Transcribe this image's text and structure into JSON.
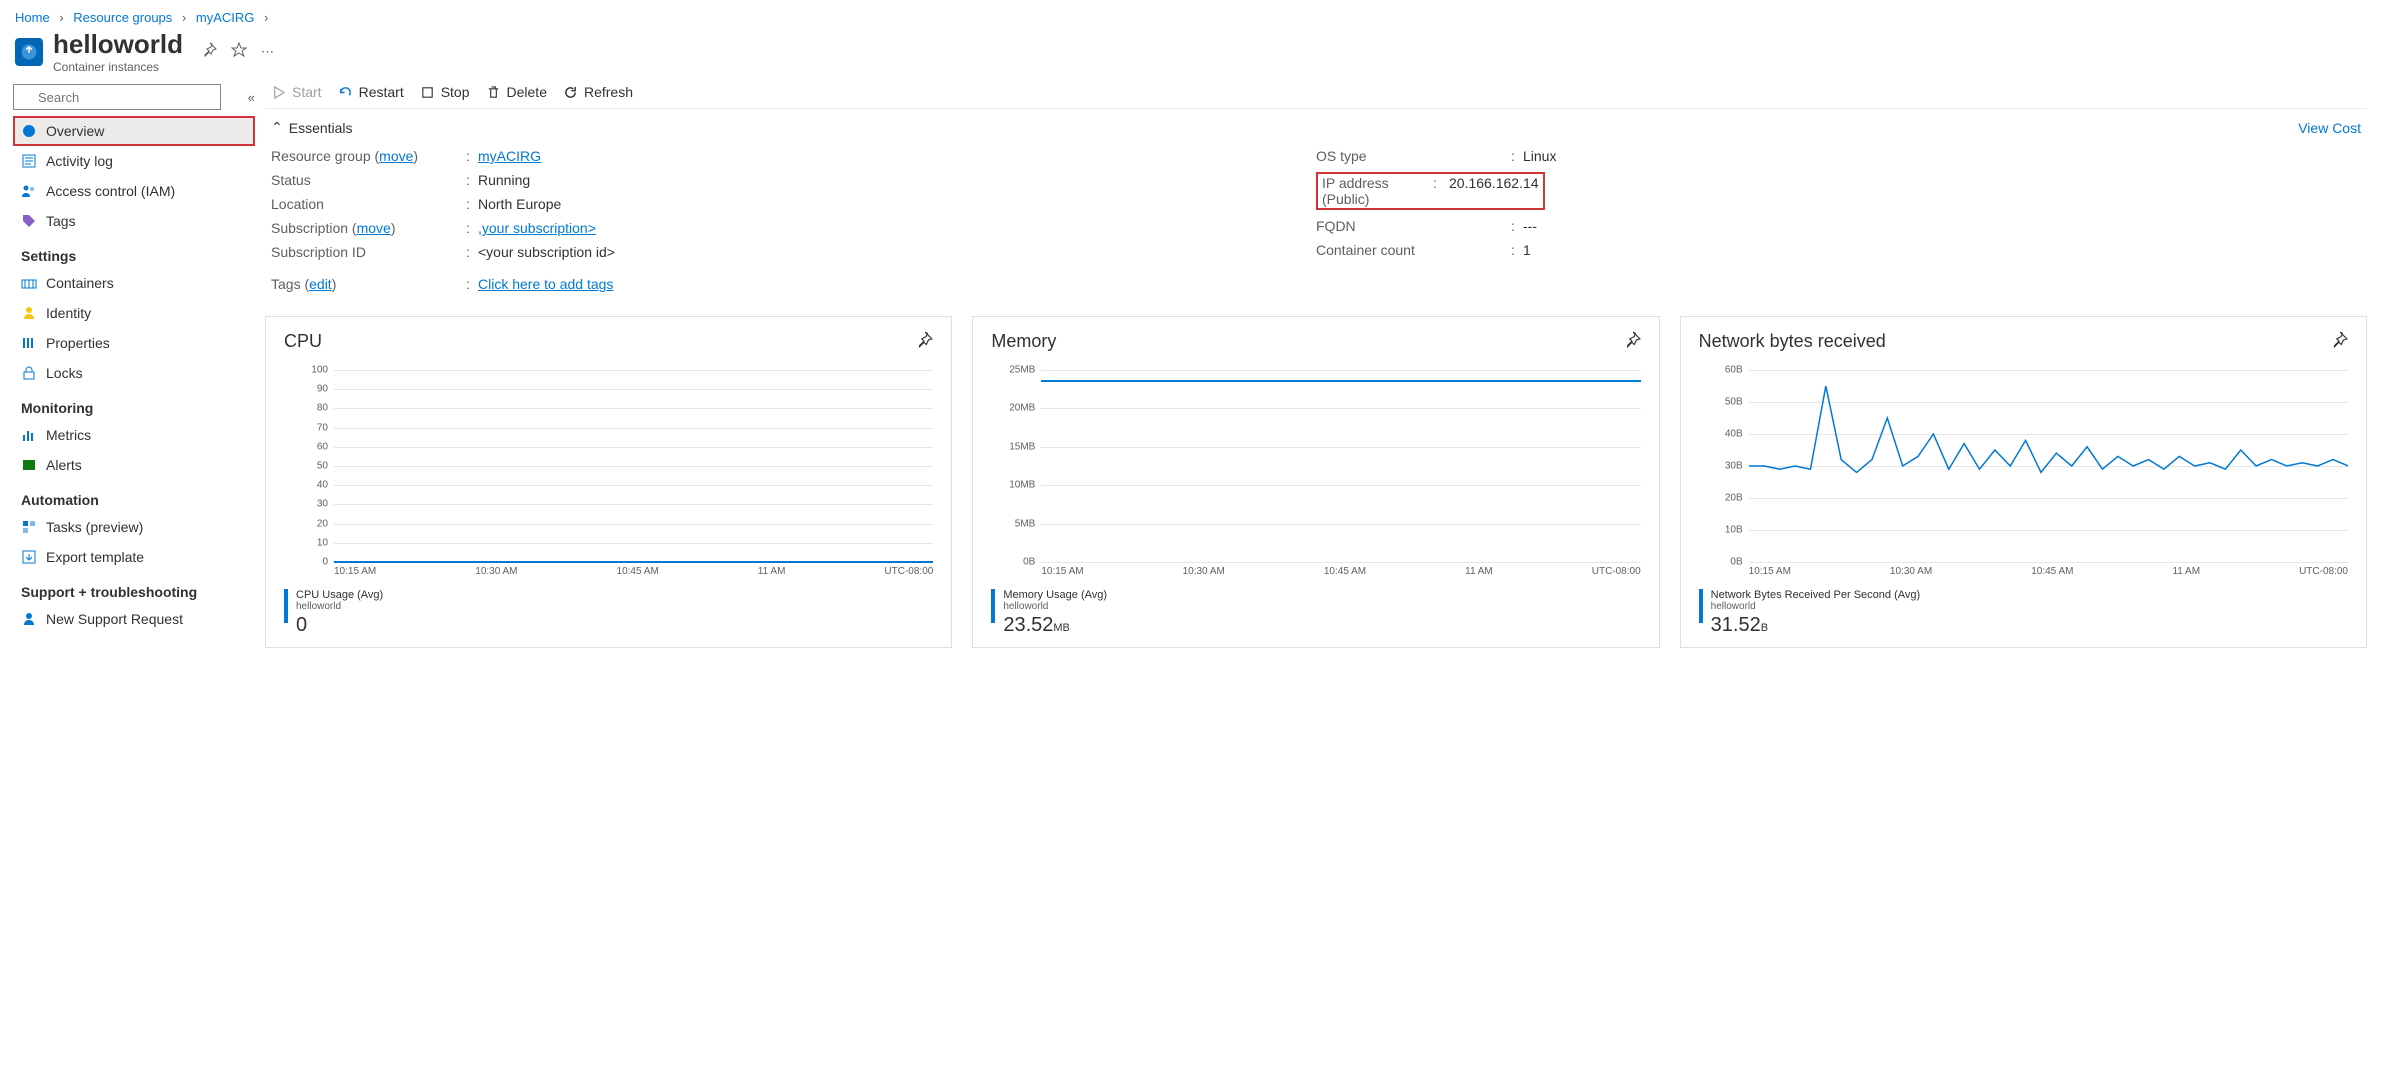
{
  "breadcrumb": {
    "home": "Home",
    "rg": "Resource groups",
    "group": "myACIRG"
  },
  "title": {
    "name": "helloworld",
    "subtype": "Container instances"
  },
  "search": {
    "placeholder": "Search"
  },
  "nav": {
    "overview": "Overview",
    "activity": "Activity log",
    "iam": "Access control (IAM)",
    "tags": "Tags",
    "settings_h": "Settings",
    "containers": "Containers",
    "identity": "Identity",
    "properties": "Properties",
    "locks": "Locks",
    "monitoring_h": "Monitoring",
    "metrics": "Metrics",
    "alerts": "Alerts",
    "automation_h": "Automation",
    "tasks": "Tasks (preview)",
    "export": "Export template",
    "support_h": "Support + troubleshooting",
    "newsupport": "New Support Request"
  },
  "toolbar": {
    "start": "Start",
    "restart": "Restart",
    "stop": "Stop",
    "delete": "Delete",
    "refresh": "Refresh"
  },
  "essentials": {
    "header": "Essentials",
    "viewcost": "View Cost",
    "rg_label": "Resource group (",
    "move": "move",
    "close_paren": ")",
    "rg_val": "myACIRG",
    "status_label": "Status",
    "status_val": "Running",
    "location_label": "Location",
    "location_val": "North Europe",
    "sub_label": "Subscription (",
    "sub_val": ",your subscription>",
    "subid_label": "Subscription ID",
    "subid_val": "<your subscription id>",
    "tags_label": "Tags (",
    "edit": "edit",
    "tags_val": "Click here to add tags",
    "os_label": "OS type",
    "os_val": "Linux",
    "ip_label": "IP address (Public)",
    "ip_val": "20.166.162.14",
    "fqdn_label": "FQDN",
    "fqdn_val": "---",
    "count_label": "Container count",
    "count_val": "1"
  },
  "charts": {
    "tz": "UTC-08:00",
    "xticks": [
      "10:15 AM",
      "10:30 AM",
      "10:45 AM",
      "11 AM"
    ],
    "cpu": {
      "title": "CPU",
      "metric_name": "CPU Usage (Avg)",
      "metric_sub": "helloworld",
      "metric_val": "0",
      "metric_unit": ""
    },
    "mem": {
      "title": "Memory",
      "metric_name": "Memory Usage (Avg)",
      "metric_sub": "helloworld",
      "metric_val": "23.52",
      "metric_unit": "MB"
    },
    "net": {
      "title": "Network bytes received",
      "metric_name": "Network Bytes Received Per Second (Avg)",
      "metric_sub": "helloworld",
      "metric_val": "31.52",
      "metric_unit": "B"
    }
  },
  "chart_data": [
    {
      "type": "line",
      "title": "CPU",
      "ylabel": "",
      "ylim": [
        0,
        100
      ],
      "yticks": [
        0,
        10,
        20,
        30,
        40,
        50,
        60,
        70,
        80,
        90,
        100
      ],
      "x": [
        "10:15 AM",
        "10:30 AM",
        "10:45 AM",
        "11 AM"
      ],
      "series": [
        {
          "name": "CPU Usage (Avg)",
          "constant": 0
        }
      ]
    },
    {
      "type": "line",
      "title": "Memory",
      "ylabel": "",
      "ylim": [
        0,
        25
      ],
      "yticks_labels": [
        "0B",
        "5MB",
        "10MB",
        "15MB",
        "20MB",
        "25MB"
      ],
      "yticks": [
        0,
        5,
        10,
        15,
        20,
        25
      ],
      "x": [
        "10:15 AM",
        "10:30 AM",
        "10:45 AM",
        "11 AM"
      ],
      "series": [
        {
          "name": "Memory Usage (Avg)",
          "constant": 23.52
        }
      ]
    },
    {
      "type": "line",
      "title": "Network bytes received",
      "ylabel": "",
      "ylim": [
        0,
        60
      ],
      "yticks_labels": [
        "0B",
        "10B",
        "20B",
        "30B",
        "40B",
        "50B",
        "60B"
      ],
      "yticks": [
        0,
        10,
        20,
        30,
        40,
        50,
        60
      ],
      "x": [
        "10:15 AM",
        "10:30 AM",
        "10:45 AM",
        "11 AM"
      ],
      "series": [
        {
          "name": "Network Bytes Received Per Second (Avg)",
          "values": [
            30,
            30,
            29,
            30,
            29,
            55,
            32,
            28,
            32,
            45,
            30,
            33,
            40,
            29,
            37,
            29,
            35,
            30,
            38,
            28,
            34,
            30,
            36,
            29,
            33,
            30,
            32,
            29,
            33,
            30,
            31,
            29,
            35,
            30,
            32,
            30,
            31,
            30,
            32,
            30
          ]
        }
      ]
    }
  ]
}
